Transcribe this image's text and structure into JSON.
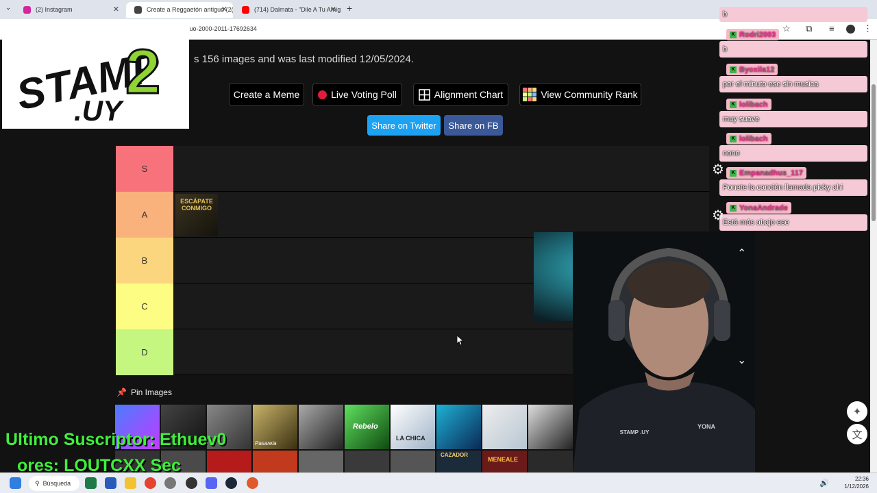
{
  "browser": {
    "tabs": [
      {
        "title": "(2) Instagram",
        "color": "#d6249f",
        "active": false
      },
      {
        "title": "Create a Reggaetón antiguo (2(",
        "color": "#444444",
        "active": true
      },
      {
        "title": "(714) Dalmata - \"Dile A Tu Amig",
        "color": "#ff0000",
        "active": false
      }
    ],
    "new_tab": "+",
    "close": "✕",
    "url": "ntiguo-2000-2011-17692634"
  },
  "page": {
    "description": "s 156 images and was last modified 12/05/2024.",
    "buttons": [
      {
        "label": "Create a Meme"
      },
      {
        "label": "Live Voting Poll",
        "icon": "red-dot-icon"
      },
      {
        "label": "Alignment Chart",
        "icon": "grid-icon"
      },
      {
        "label": "View Community Rank",
        "icon": "mosaic-icon"
      }
    ],
    "share": [
      {
        "label": "Share on Twitter",
        "color": "#1da1f2"
      },
      {
        "label": "Share on FB",
        "color": "#3b5998"
      }
    ],
    "tiers": [
      {
        "label": "S",
        "color": "#f7727a"
      },
      {
        "label": "A",
        "color": "#f9b27b"
      },
      {
        "label": "B",
        "color": "#fbd67e"
      },
      {
        "label": "C",
        "color": "#fdfd84"
      },
      {
        "label": "D",
        "color": "#c4f680"
      }
    ],
    "tier_a_item": "ESCÁPATE CONMIGO",
    "pin_title": "Pin Images",
    "pin_labels": [
      "LA CHICA",
      "Pasarela",
      "Rebelo",
      "CAZADOR",
      "MENEALE"
    ]
  },
  "overlay": {
    "logo_text": "STAMP 2 .UY",
    "chat": [
      {
        "user": "",
        "message": "b"
      },
      {
        "user": "Rodri2003",
        "message": "b"
      },
      {
        "user": "Byoxila12",
        "message": "por el minuto ese sin musica"
      },
      {
        "user": "lolibach",
        "message": "muy suave"
      },
      {
        "user": "lolibach",
        "message": "nono"
      },
      {
        "user": "Empanadhus_117",
        "message": "Ponete la canción llamada picky ahi"
      },
      {
        "user": "YonaAndrade",
        "message": "Está más abajo ese"
      }
    ],
    "ticker_line1": "Ultimo Suscriptor: Ethuev0",
    "ticker_line2": "ores: LOUTCXX   Sec",
    "webcam_shirt_text": "STAMP .UY",
    "webcam_logo_text": "YONA"
  },
  "taskbar": {
    "search": "Búsqueda",
    "time": "22:36",
    "date": "1/12/2026",
    "apps": [
      "windows",
      "excel",
      "word",
      "files",
      "chrome",
      "settings",
      "obs",
      "discord",
      "steam",
      "media"
    ]
  }
}
